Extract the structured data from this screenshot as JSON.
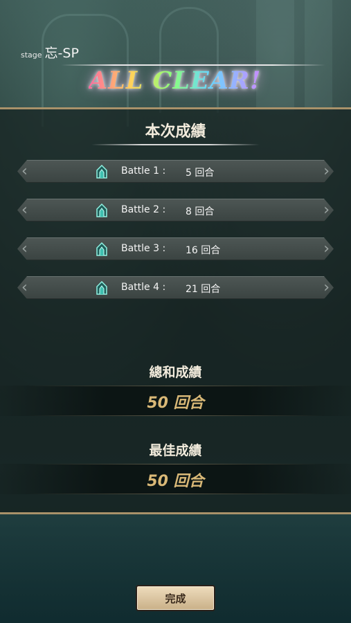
{
  "header": {
    "stage_prefix": "stage",
    "stage_name": "忘-SP",
    "banner": "ALL CLEAR!"
  },
  "current": {
    "title": "本次成績",
    "battles": [
      {
        "label": "Battle 1 :",
        "value": "5 回合",
        "icon": "crystal-gate-icon"
      },
      {
        "label": "Battle 2 :",
        "value": "8 回合",
        "icon": "crystal-gate-icon"
      },
      {
        "label": "Battle 3 :",
        "value": "16 回合",
        "icon": "crystal-gate-icon"
      },
      {
        "label": "Battle 4 :",
        "value": "21 回合",
        "icon": "crystal-gate-icon"
      }
    ]
  },
  "total": {
    "title": "總和成績",
    "value": "50 回合"
  },
  "best": {
    "title": "最佳成績",
    "value": "50 回合"
  },
  "actions": {
    "done_label": "完成"
  },
  "colors": {
    "accent_gold": "#d9b877",
    "panel_border": "#a9926a",
    "icon_teal": "#3fc0b0"
  }
}
